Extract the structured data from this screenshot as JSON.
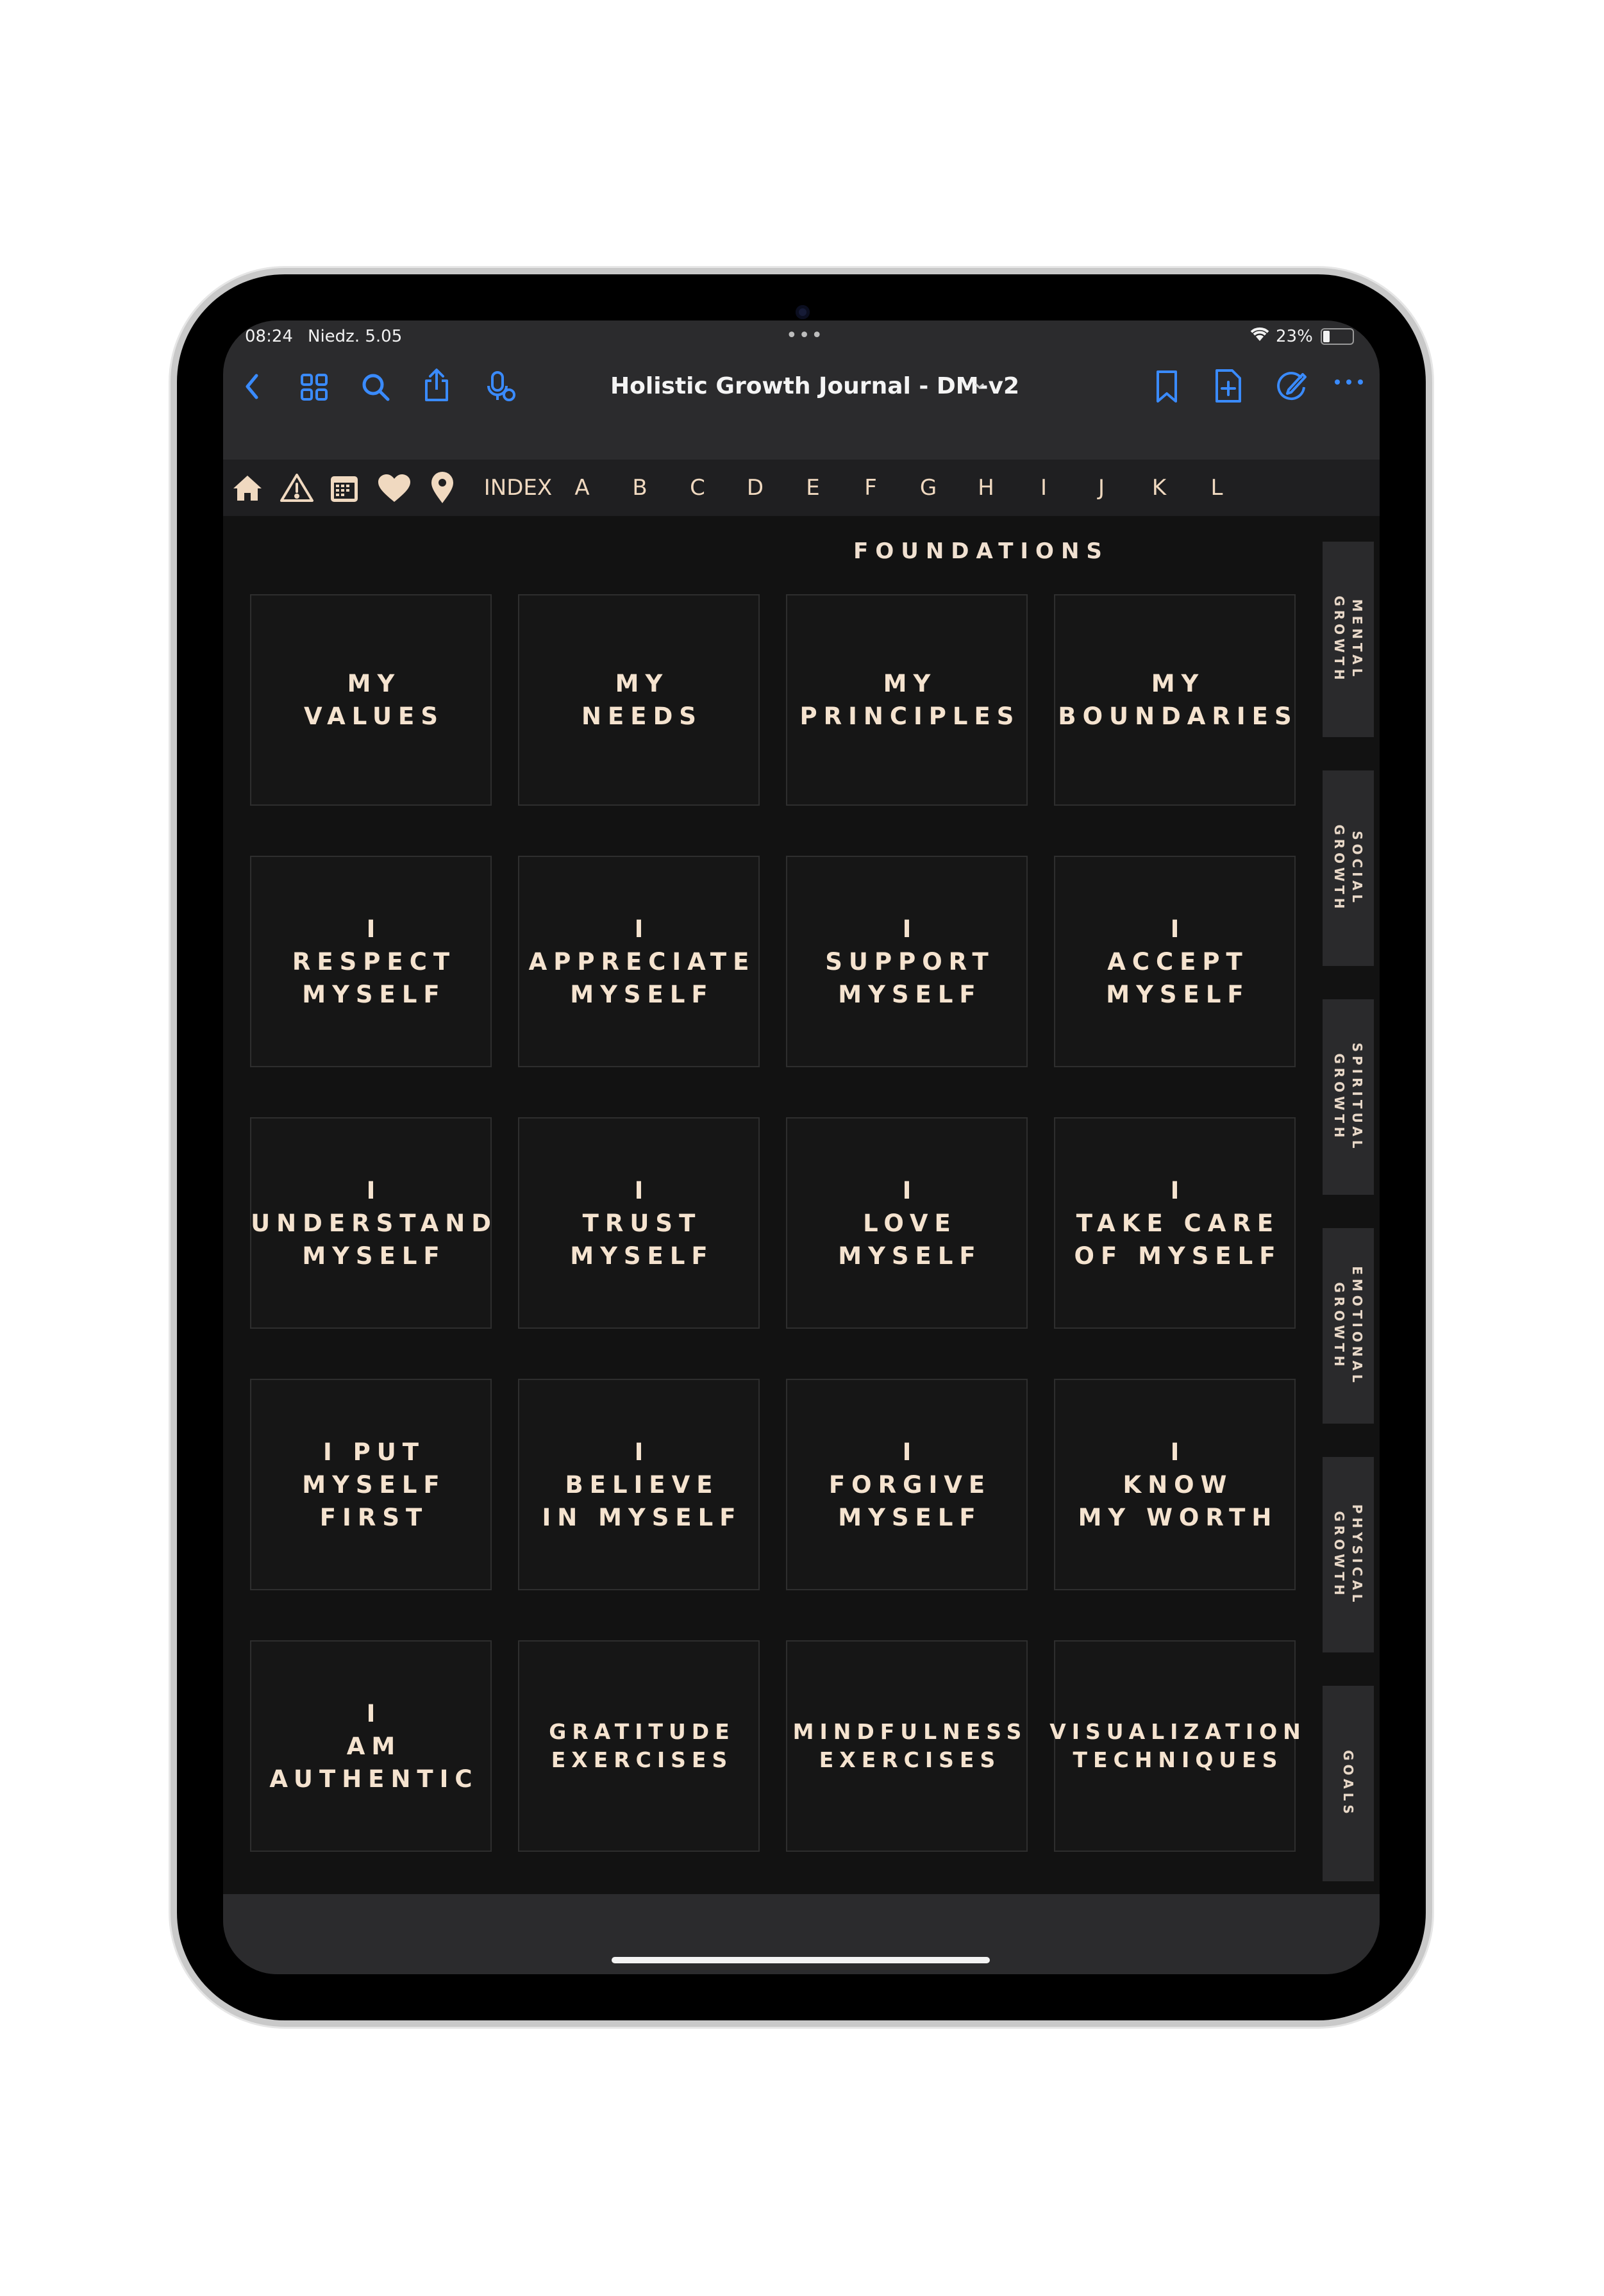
{
  "status": {
    "time": "08:24",
    "date": "Niedz. 5.05",
    "battery": "23%"
  },
  "nav": {
    "title": "Holistic Growth Journal - DM-v2",
    "accent": "#3a8bff"
  },
  "tabs": [
    "INDEX",
    "A",
    "B",
    "C",
    "D",
    "E",
    "F",
    "G",
    "H",
    "I",
    "J",
    "K",
    "L"
  ],
  "tab_icons": [
    "home-icon",
    "warning-icon",
    "calendar-icon",
    "heart-icon",
    "location-pin-icon"
  ],
  "section_title": "FOUNDATIONS",
  "cards": [
    "MY\nVALUES",
    "MY\nNEEDS",
    "MY\nPRINCIPLES",
    "MY\nBOUNDARIES",
    "I\nRESPECT\nMYSELF",
    "I\nAPPRECIATE\nMYSELF",
    "I\nSUPPORT\nMYSELF",
    "I\nACCEPT\nMYSELF",
    "I\nUNDERSTAND\nMYSELF",
    "I\nTRUST\nMYSELF",
    "I\nLOVE\nMYSELF",
    "I\nTAKE CARE\nOF MYSELF",
    "I PUT\nMYSELF\nFIRST",
    "I\nBELIEVE\nIN MYSELF",
    "I\nFORGIVE\nMYSELF",
    "I\nKNOW\nMY WORTH",
    "I\nAM\nAUTHENTIC",
    "GRATITUDE\nEXERCISES",
    "MINDFULNESS\nEXERCISES",
    "VISUALIZATION\nTECHNIQUES"
  ],
  "side_tabs": [
    "MENTAL\nGROWTH",
    "SOCIAL\nGROWTH",
    "SPIRITUAL\nGROWTH",
    "EMOTIONAL\nGROWTH",
    "PHYSICAL\nGROWTH",
    "GOALS"
  ],
  "colors": {
    "page_bg": "#121212",
    "text_cream": "#f5e3cf",
    "tab_bg": "#2a2a2c"
  }
}
